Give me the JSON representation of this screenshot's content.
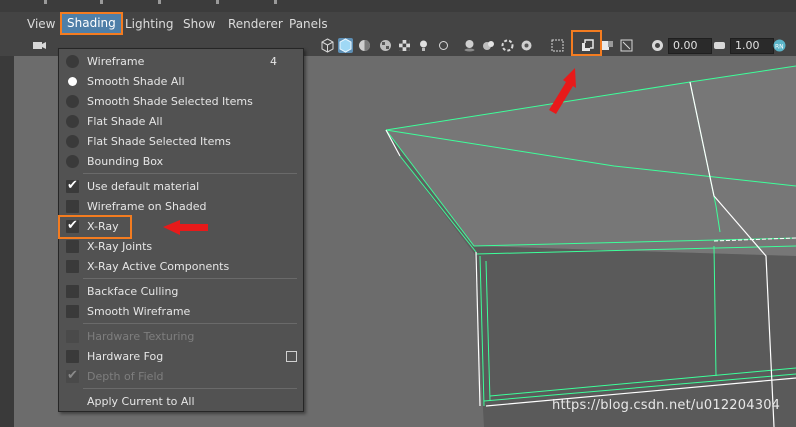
{
  "menubar": {
    "items": [
      "View",
      "Shading",
      "Lighting",
      "Show",
      "Renderer",
      "Panels"
    ],
    "active": "Shading"
  },
  "toolbar": {
    "field1_value": "0.00",
    "field2_value": "1.00",
    "icons": [
      "camera-icon",
      "wireframe-cube-icon",
      "smooth-shade-cube-icon",
      "flat-shade-icon",
      "checker-icon",
      "light-bulb-icon",
      "isolate-icon",
      "xray-icon",
      "xray-active-icon",
      "backface-icon",
      "resolution-gate-icon"
    ]
  },
  "shading_menu": {
    "items": [
      {
        "label": "Wireframe",
        "kind": "radio",
        "checked": false,
        "hotkey": "4"
      },
      {
        "label": "Smooth Shade All",
        "kind": "radio",
        "checked": true
      },
      {
        "label": "Smooth Shade Selected Items",
        "kind": "radio",
        "checked": false
      },
      {
        "label": "Flat Shade All",
        "kind": "radio",
        "checked": false
      },
      {
        "label": "Flat Shade Selected Items",
        "kind": "radio",
        "checked": false
      },
      {
        "label": "Bounding Box",
        "kind": "radio",
        "checked": false
      },
      {
        "label": "Use default material",
        "kind": "check",
        "checked": true
      },
      {
        "label": "Wireframe on Shaded",
        "kind": "check",
        "checked": false
      },
      {
        "label": "X-Ray",
        "kind": "check",
        "checked": true
      },
      {
        "label": "X-Ray Joints",
        "kind": "check",
        "checked": false
      },
      {
        "label": "X-Ray Active Components",
        "kind": "check",
        "checked": false
      },
      {
        "label": "Backface Culling",
        "kind": "check",
        "checked": false
      },
      {
        "label": "Smooth Wireframe",
        "kind": "check",
        "checked": false
      },
      {
        "label": "Hardware Texturing",
        "kind": "check",
        "checked": false,
        "disabled": true
      },
      {
        "label": "Hardware Fog",
        "kind": "check",
        "checked": false,
        "option_box": true
      },
      {
        "label": "Depth of Field",
        "kind": "check",
        "checked": true,
        "disabled": true
      },
      {
        "label": "Apply Current to All",
        "kind": "action"
      }
    ]
  },
  "watermark": "https://blog.csdn.net/u012204304",
  "colors": {
    "highlight": "#f47c20",
    "arrow": "#e81a1a",
    "wire": "#3dff9a",
    "menu_active": "#4f7fa8"
  }
}
